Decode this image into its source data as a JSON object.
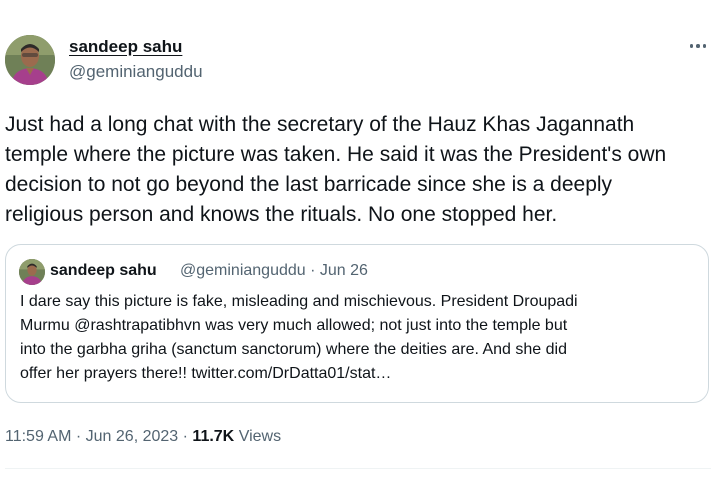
{
  "author": {
    "display_name": "sandeep sahu",
    "handle": "@geminianguddu"
  },
  "tweet": {
    "text": "Just had a long chat with the secretary of the Hauz Khas Jagannath\ntemple where the picture was taken. He said it was the President's own\ndecision to not go beyond the last barricade since she is a deeply\nreligious person and knows the rituals. No one stopped her."
  },
  "quoted_tweet": {
    "display_name": "sandeep sahu",
    "handle": "@geminianguddu",
    "separator": "·",
    "date": "Jun 26",
    "text": "I dare say this picture is fake, misleading and mischievous. President Droupadi\nMurmu @rashtrapatibhvn was very much allowed; not just into the temple but\ninto the garbha griha (sanctum sanctorum) where the deities are. And she did\noffer her prayers there!! twitter.com/DrDatta01/stat…"
  },
  "meta": {
    "time": "11:59 AM",
    "separator": "·",
    "date": "Jun 26, 2023",
    "views_count": "11.7K",
    "views_label": "Views"
  },
  "icons": {
    "more": "more-horizontal-icon"
  },
  "colors": {
    "text": "#0f1419",
    "secondary": "#536471",
    "border": "#cfd9de"
  }
}
